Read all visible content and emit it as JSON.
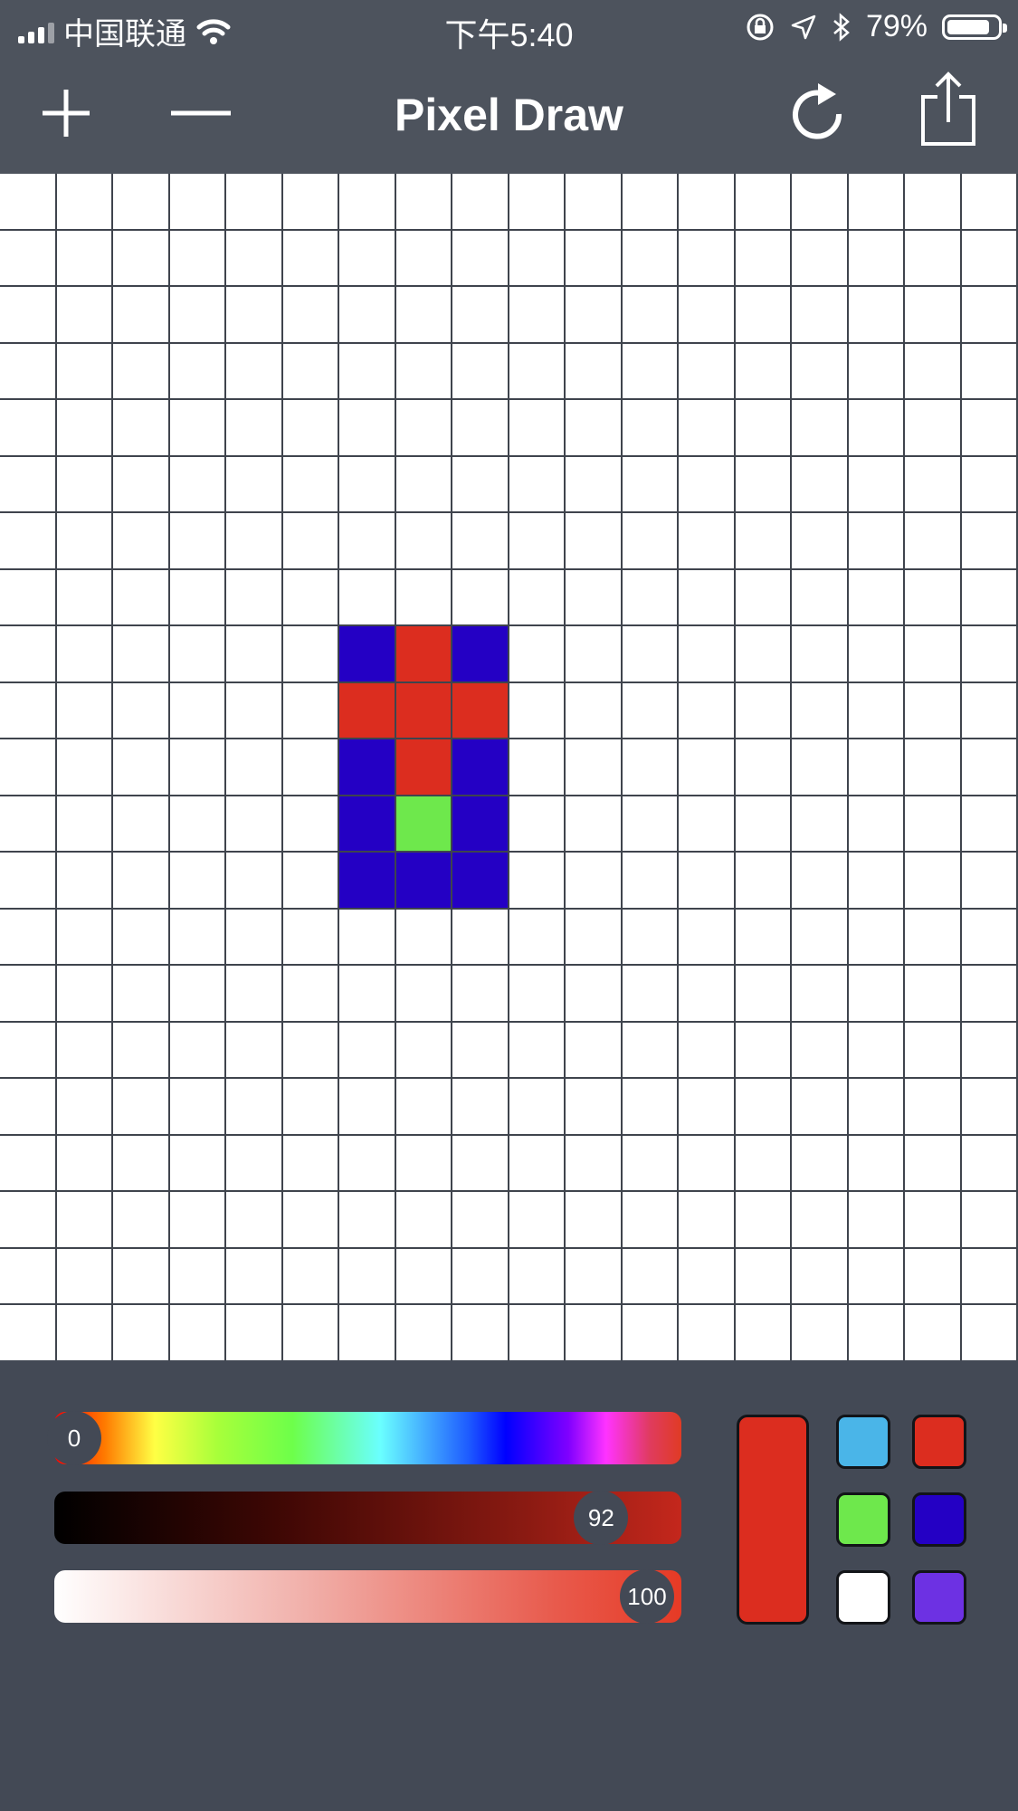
{
  "status_bar": {
    "carrier": "中国联通",
    "time": "下午5:40",
    "battery_percent": "79%"
  },
  "nav": {
    "title": "Pixel Draw",
    "icons": [
      "plus-icon",
      "minus-icon",
      "refresh-icon",
      "share-icon"
    ]
  },
  "canvas": {
    "columns": 18,
    "rows": 21,
    "grid_color": "#3f444d",
    "empty_color": "#ffffff",
    "painted_cells": [
      {
        "row": 8,
        "col": 6,
        "color": "#2400c4"
      },
      {
        "row": 8,
        "col": 7,
        "color": "#dc2d1f"
      },
      {
        "row": 8,
        "col": 8,
        "color": "#2400c4"
      },
      {
        "row": 9,
        "col": 6,
        "color": "#dc2d1f"
      },
      {
        "row": 9,
        "col": 7,
        "color": "#dc2d1f"
      },
      {
        "row": 9,
        "col": 8,
        "color": "#dc2d1f"
      },
      {
        "row": 10,
        "col": 6,
        "color": "#2400c4"
      },
      {
        "row": 10,
        "col": 7,
        "color": "#dc2d1f"
      },
      {
        "row": 10,
        "col": 8,
        "color": "#2400c4"
      },
      {
        "row": 11,
        "col": 6,
        "color": "#2400c4"
      },
      {
        "row": 11,
        "col": 7,
        "color": "#6ee84c"
      },
      {
        "row": 11,
        "col": 8,
        "color": "#2400c4"
      },
      {
        "row": 12,
        "col": 6,
        "color": "#2400c4"
      },
      {
        "row": 12,
        "col": 7,
        "color": "#2400c4"
      },
      {
        "row": 12,
        "col": 8,
        "color": "#2400c4"
      }
    ]
  },
  "sliders": {
    "hue": {
      "value_label": "0",
      "fraction": 0.0
    },
    "brightness": {
      "value_label": "92",
      "fraction": 0.92
    },
    "saturation": {
      "value_label": "100",
      "fraction": 1.0
    }
  },
  "current_color": "#dc2d1f",
  "palette": [
    "#4ab5e8",
    "#dc2d1f",
    "#6ee84c",
    "#2400c4",
    "#ffffff",
    "#6d31e3"
  ]
}
